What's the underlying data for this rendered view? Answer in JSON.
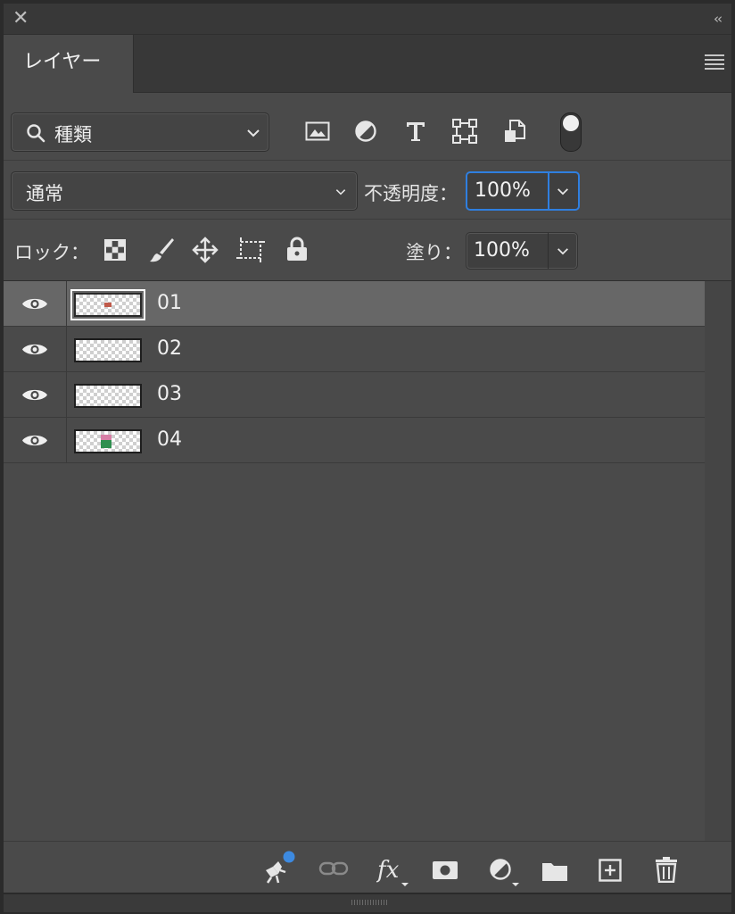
{
  "panel": {
    "tab_label": "レイヤー"
  },
  "filter": {
    "kind_label": "種類"
  },
  "blend": {
    "mode": "通常",
    "opacity_label": "不透明度：",
    "opacity_value": "100%"
  },
  "lock": {
    "label": "ロック：",
    "fill_label": "塗り：",
    "fill_value": "100%"
  },
  "layers": [
    {
      "name": "01",
      "selected": true
    },
    {
      "name": "02",
      "selected": false
    },
    {
      "name": "03",
      "selected": false
    },
    {
      "name": "04",
      "selected": false
    }
  ],
  "colors": {
    "accent": "#2f7fe0",
    "panel_bg": "#4a4a4a",
    "selected_row": "#676767"
  }
}
